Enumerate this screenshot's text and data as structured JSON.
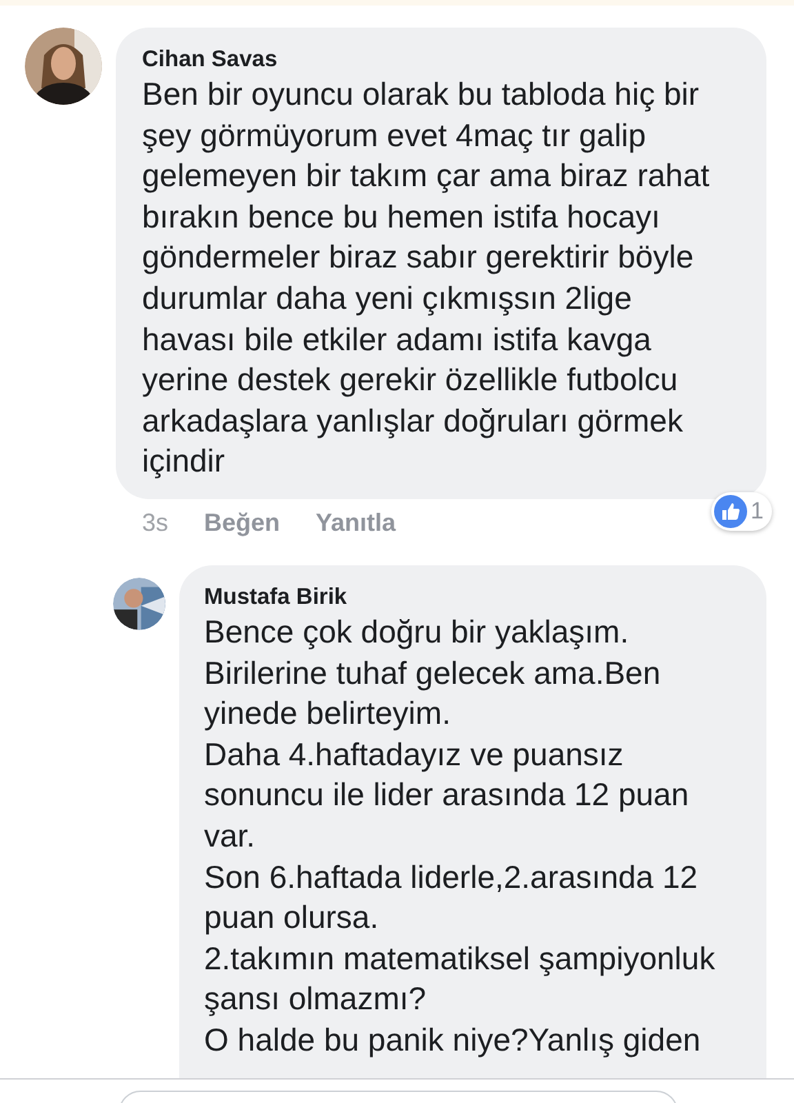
{
  "comments": [
    {
      "author": "Cihan Savas",
      "paragraphs": [
        "Ben bir oyuncu olarak bu tabloda hiç bir şey görmüyorum evet 4maç tır galip gelemeyen bir takım çar ama biraz rahat bırakın bence bu hemen istifa hocayı göndermeler biraz sabır gerektirir böyle durumlar daha yeni çıkmışsın 2lige havası bile etkiler adamı istifa kavga yerine destek gerekir özellikle futbolcu arkadaşlara yanlışlar doğruları görmek içindir"
      ],
      "time": "3s",
      "actions": [
        "Beğen",
        "Yanıtla"
      ],
      "reaction_count": "1"
    },
    {
      "author": "Mustafa Birik",
      "paragraphs": [
        "Bence çok doğru bir yaklaşım.",
        "Birilerine tuhaf gelecek ama.Ben yinede belirteyim.",
        "Daha 4.haftadayız ve puansız sonuncu ile lider arasında 12 puan var.",
        "Son 6.haftada liderle,2.arasında 12 puan olursa.",
        "2.takımın matematiksel şampiyonluk şansı olmazmı?",
        "O halde bu panik niye?Yanlış giden"
      ]
    }
  ]
}
